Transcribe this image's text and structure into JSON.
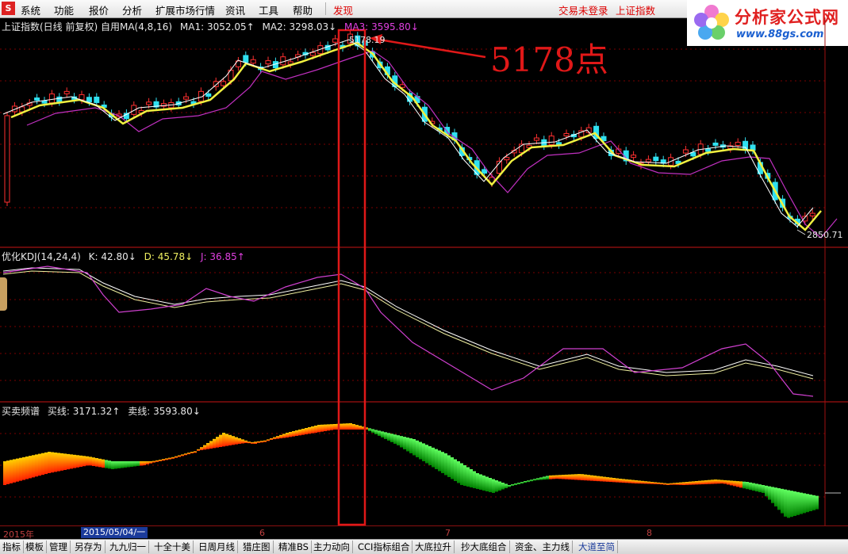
{
  "menu": {
    "items": [
      "系统",
      "功能",
      "报价",
      "分析",
      "扩展市场行情",
      "资讯",
      "工具",
      "帮助",
      "发现"
    ],
    "status_login": "交易未登录",
    "status_index": "上证指数"
  },
  "logo": {
    "title": "分析家公式网",
    "url": "www.88gs.com"
  },
  "price_panel": {
    "title": "上证指数(日线 前复权) 自用MA(4,8,16)",
    "ma1": "MA1: 3052.05↑",
    "ma2": "MA2: 3298.03↓",
    "ma3": "MA3: 3595.80↓",
    "high_label": "5178.19",
    "low_label": "2850.71"
  },
  "annotation": "5178点",
  "kdj_panel": {
    "title": "优化KDJ(14,24,4)",
    "k": "K: 42.80↓",
    "d": "D: 45.78↓",
    "j": "J: 36.85↑"
  },
  "spectrum_panel": {
    "title": "买卖频谱",
    "buy": "买线: 3171.32↑",
    "sell": "卖线: 3593.80↓"
  },
  "time_axis": {
    "year": "2015年",
    "cursor": "2015/05/04/一",
    "months": [
      "6",
      "7",
      "8"
    ]
  },
  "toolbar": {
    "items": [
      "指标",
      "模板",
      "管理",
      "另存为",
      "九九归一",
      "十全十美",
      "日周月线",
      "猎庄图",
      "精准BS",
      "主力动向",
      "CCI指标组合",
      "大底拉升",
      "抄大底组合",
      "资金、主力线",
      "大道至简"
    ],
    "active_index": 14
  },
  "colors": {
    "up": "#ff3030",
    "down": "#30e0f0",
    "ma_fast": "#ffffff",
    "ma_mid": "#f0f040",
    "ma_slow": "#c030c0",
    "grid": "#7a0000",
    "highlight_box": "#e01818"
  }
}
